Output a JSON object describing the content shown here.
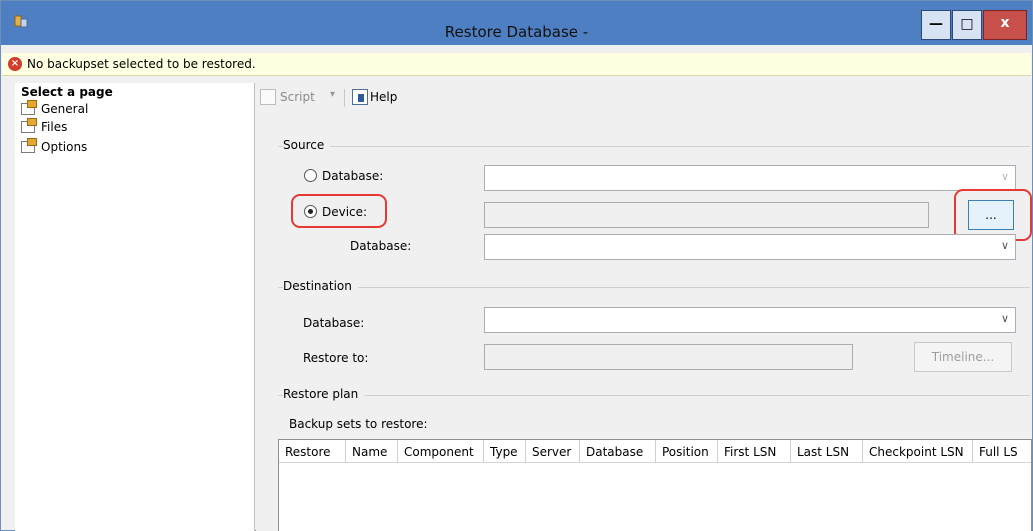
{
  "window": {
    "title": "Restore Database -",
    "controls": {
      "minimize": "—",
      "maximize": "□",
      "close": "x"
    }
  },
  "error": {
    "message": "No backupset selected to be restored.",
    "icon": "error-icon"
  },
  "nav": {
    "header": "Select a page",
    "items": [
      {
        "label": "General"
      },
      {
        "label": "Files"
      },
      {
        "label": "Options"
      }
    ]
  },
  "toolbar": {
    "script": "Script",
    "dropdown": "▾",
    "help": "Help"
  },
  "source": {
    "group": "Source",
    "database_label": "Database:",
    "database_value": "",
    "device_label": "Device:",
    "device_value": "",
    "browse_label": "...",
    "sub_database_label": "Database:",
    "sub_database_value": "",
    "selected": "device"
  },
  "destination": {
    "group": "Destination",
    "database_label": "Database:",
    "database_value": "",
    "restore_to_label": "Restore to:",
    "restore_to_value": "",
    "timeline_label": "Timeline..."
  },
  "plan": {
    "group": "Restore plan",
    "backup_sets_label": "Backup sets to restore:",
    "columns": [
      "Restore",
      "Name",
      "Component",
      "Type",
      "Server",
      "Database",
      "Position",
      "First LSN",
      "Last LSN",
      "Checkpoint LSN",
      "Full LS"
    ]
  },
  "colors": {
    "titlebar": "#4f7fc3",
    "highlight": "#e53935",
    "error_bg": "#ffffe1"
  }
}
